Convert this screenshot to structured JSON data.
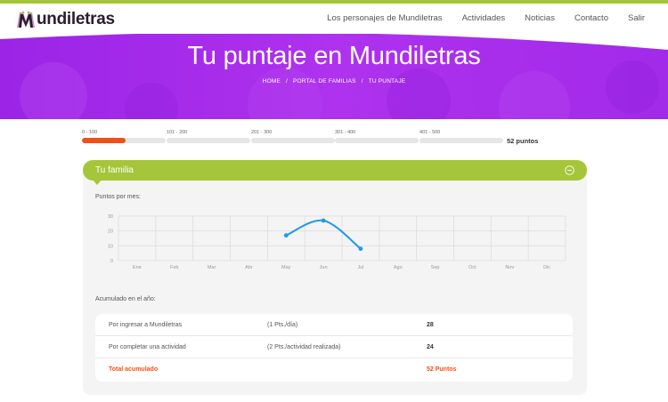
{
  "header": {
    "logo_text": "undiletras",
    "nav": [
      "Los personajes de Mundiletras",
      "Actividades",
      "Noticias",
      "Contacto",
      "Salir"
    ]
  },
  "hero": {
    "title": "Tu puntaje en Mundiletras",
    "breadcrumb": [
      "HOME",
      "PORTAL DE FAMILIAS",
      "TU PUNTAJE"
    ],
    "breadcrumb_sep": "/"
  },
  "tiers": {
    "labels": [
      "0 - 100",
      "101 - 200",
      "201 - 300",
      "301 - 400",
      "401 - 500"
    ],
    "current_tier_fill": 0.52,
    "total": "52 puntos"
  },
  "panel": {
    "title": "Tu familia",
    "chart_label": "Puntos por mes:",
    "accumulated_label": "Acumulado en el año:",
    "rows": [
      {
        "concept": "Por ingresar a Mundiletras",
        "rate": "(1 Pts./día)",
        "value": "28"
      },
      {
        "concept": "Por completar una actividad",
        "rate": "(2 Pts./actividad realizada)",
        "value": "24"
      }
    ],
    "total_row": {
      "concept": "Total acumulado",
      "value": "52 Puntos"
    }
  },
  "chart_data": {
    "type": "line",
    "categories": [
      "Ene",
      "Feb",
      "Mar",
      "Abr",
      "May",
      "Jun",
      "Jul",
      "Ago",
      "Sep",
      "Oct",
      "Nov",
      "Dic"
    ],
    "series": [
      {
        "values": [
          null,
          null,
          null,
          null,
          17,
          27,
          8
        ]
      }
    ],
    "y_ticks": [
      0,
      10,
      20,
      30
    ],
    "ylim": [
      0,
      30
    ],
    "grid": true,
    "title": "",
    "xlabel": "",
    "ylabel": ""
  },
  "colors": {
    "accent_green": "#a5c638",
    "hero_purple": "#a92bec",
    "progress_orange": "#f24f16",
    "line_blue": "#1c9be6"
  }
}
